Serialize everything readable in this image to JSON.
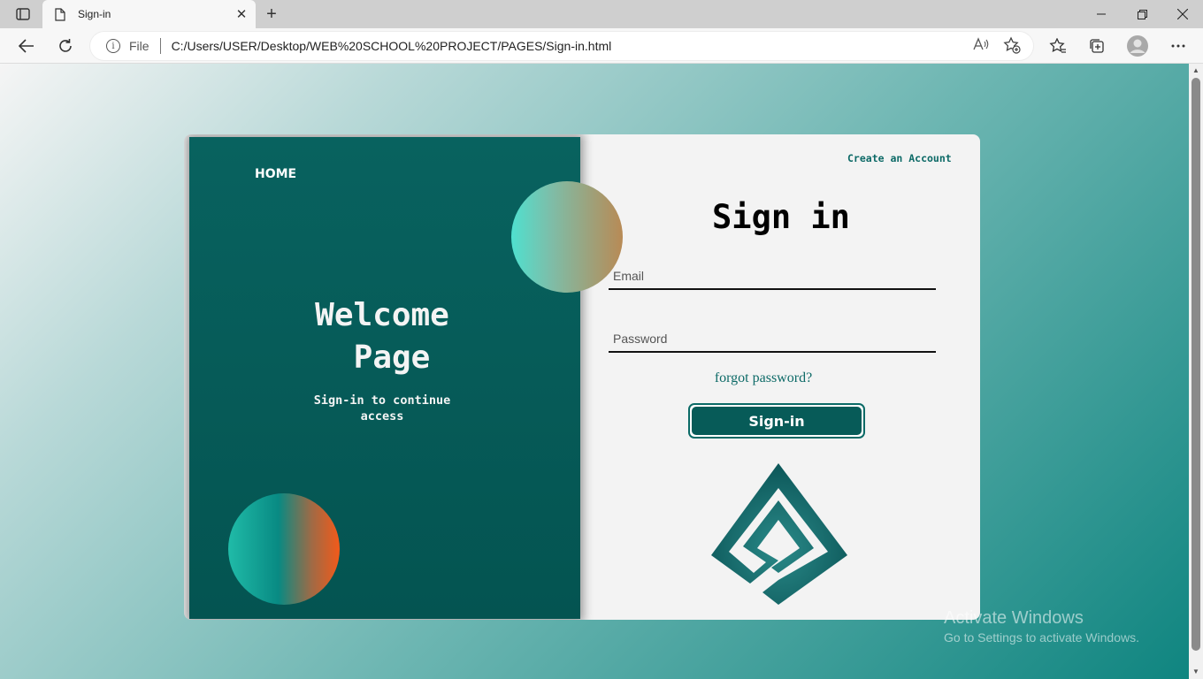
{
  "browser": {
    "tab_title": "Sign-in",
    "tab_close": "✕",
    "new_tab": "+",
    "address_prefix": "File",
    "url": "C:/Users/USER/Desktop/WEB%20SCHOOL%20PROJECT/PAGES/Sign-in.html",
    "read_aloud": "A⁾",
    "window_controls": {
      "minimize": "—",
      "restore": "❐",
      "close": "✕"
    },
    "info_glyph": "i"
  },
  "page": {
    "home_label": "HOME",
    "welcome_line1": "Welcome",
    "welcome_line2": "Page",
    "subtitle_line1": "Sign-in to continue",
    "subtitle_line2": "access",
    "create_account": "Create an Account",
    "title": "Sign in",
    "email_placeholder": "Email",
    "password_placeholder": "Password",
    "forgot": "forgot password?",
    "signin_button": "Sign-in"
  },
  "watermark": {
    "line1": "Activate Windows",
    "line2": "Go to Settings to activate Windows."
  },
  "colors": {
    "accent": "#075b58",
    "link": "#0d6a67"
  }
}
